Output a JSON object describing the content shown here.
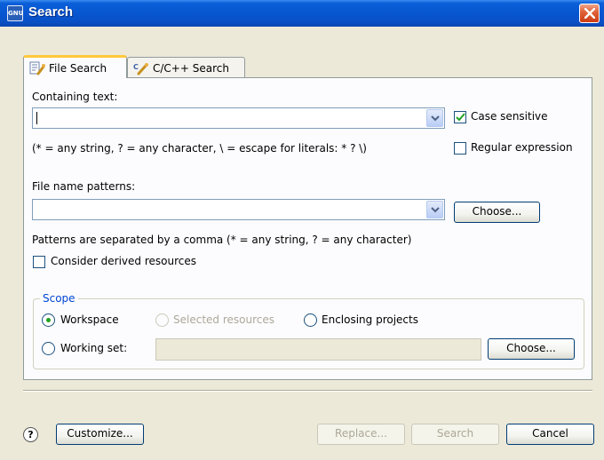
{
  "window": {
    "title": "Search",
    "icon": "eclipse-search-icon"
  },
  "tabs": [
    {
      "label": "File Search",
      "icon": "file-search-icon",
      "active": true
    },
    {
      "label": "C/C++ Search",
      "icon": "cpp-search-icon",
      "active": false
    }
  ],
  "containing_text": {
    "label": "Containing text:",
    "value": "",
    "hint": "(* = any string, ? = any character, \\ = escape for literals: * ? \\)",
    "case_sensitive": {
      "label": "Case sensitive",
      "checked": true
    },
    "regex": {
      "label": "Regular expression",
      "checked": false
    }
  },
  "file_patterns": {
    "label": "File name patterns:",
    "value": "",
    "choose_label": "Choose...",
    "hint": "Patterns are separated by a comma (* = any string, ? = any character)",
    "derived": {
      "label": "Consider derived resources",
      "checked": false
    }
  },
  "scope": {
    "title": "Scope",
    "workspace": {
      "label": "Workspace",
      "selected": true
    },
    "selected_resources": {
      "label": "Selected resources",
      "enabled": false
    },
    "enclosing_projects": {
      "label": "Enclosing projects"
    },
    "working_set": {
      "label": "Working set:",
      "value": "",
      "choose_label": "Choose..."
    }
  },
  "footer": {
    "customize_label": "Customize...",
    "replace_label": "Replace...",
    "search_label": "Search",
    "cancel_label": "Cancel"
  },
  "colors": {
    "accent": "#0a5fd8",
    "close": "#cc3c14",
    "tab_highlight": "#ffc83c",
    "group_title": "#0046d5"
  }
}
